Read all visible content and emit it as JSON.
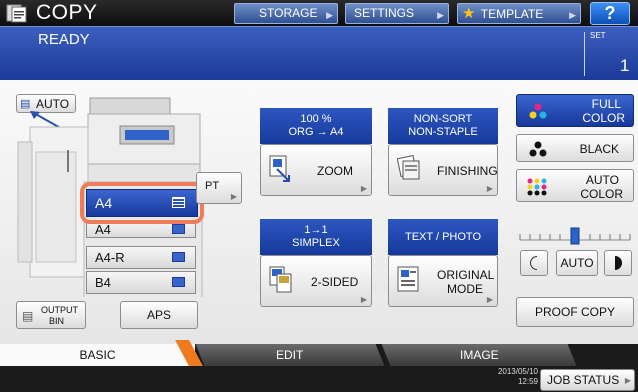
{
  "header": {
    "app_title": "COPY",
    "storage_label": "STORAGE",
    "settings_label": "SETTINGS",
    "template_label": "TEMPLATE",
    "help_label": "?"
  },
  "status": {
    "text": "READY",
    "set_label": "SET",
    "set_count": "1"
  },
  "machine": {
    "auto_label": "AUTO",
    "output_bin_line1": "OUTPUT",
    "output_bin_line2": "BIN",
    "aps_label": "APS",
    "partial_pt_label": "PT"
  },
  "trays": {
    "selected": "A4",
    "items": [
      "A4",
      "A4-R",
      "B4"
    ]
  },
  "zoom": {
    "header_line1": "100 %",
    "header_line2": "ORG  →  A4",
    "label": "ZOOM"
  },
  "finishing": {
    "header_line1": "NON-SORT",
    "header_line2": "NON-STAPLE",
    "label": "FINISHING"
  },
  "duplex": {
    "header_line1": "1→1",
    "header_line2": "SIMPLEX",
    "label": "2-SIDED"
  },
  "original_mode": {
    "header": "TEXT / PHOTO",
    "label_line1": "ORIGINAL",
    "label_line2": "MODE"
  },
  "color": {
    "full_color_line1": "FULL",
    "full_color_line2": "COLOR",
    "black_label": "BLACK",
    "auto_color_line1": "AUTO",
    "auto_color_line2": "COLOR"
  },
  "density": {
    "auto_label": "AUTO",
    "level": 0.5
  },
  "proof_copy_label": "PROOF COPY",
  "tabs": {
    "basic": "BASIC",
    "edit": "EDIT",
    "image": "IMAGE"
  },
  "footer": {
    "date": "2013/05/10",
    "time": "12:59",
    "job_status_label": "JOB STATUS"
  },
  "colors": {
    "accent_blue": "#1c3a98",
    "highlight": "#ef7b5b",
    "tab_accent": "#f07a1e"
  }
}
